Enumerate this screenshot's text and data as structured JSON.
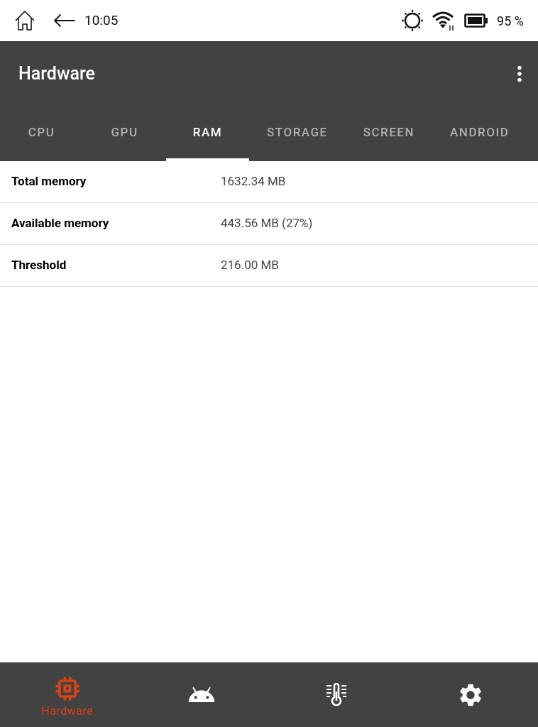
{
  "status_bar": {
    "time": "10:05",
    "battery": "95 %"
  },
  "app_bar": {
    "title": "Hardware"
  },
  "tabs": [
    {
      "label": "CPU",
      "selected": false
    },
    {
      "label": "GPU",
      "selected": false
    },
    {
      "label": "RAM",
      "selected": true
    },
    {
      "label": "STORAGE",
      "selected": false
    },
    {
      "label": "SCREEN",
      "selected": false
    },
    {
      "label": "ANDROID",
      "selected": false
    }
  ],
  "rows": [
    {
      "label": "Total memory",
      "value": "1632.34 MB"
    },
    {
      "label": "Available memory",
      "value": "443.56 MB (27%)"
    },
    {
      "label": "Threshold",
      "value": "216.00 MB"
    }
  ],
  "bottom_nav": [
    {
      "kind": "chip",
      "label": "Hardware",
      "selected": true
    },
    {
      "kind": "android",
      "selected": false
    },
    {
      "kind": "thermometer",
      "selected": false
    },
    {
      "kind": "gear",
      "selected": false
    }
  ]
}
